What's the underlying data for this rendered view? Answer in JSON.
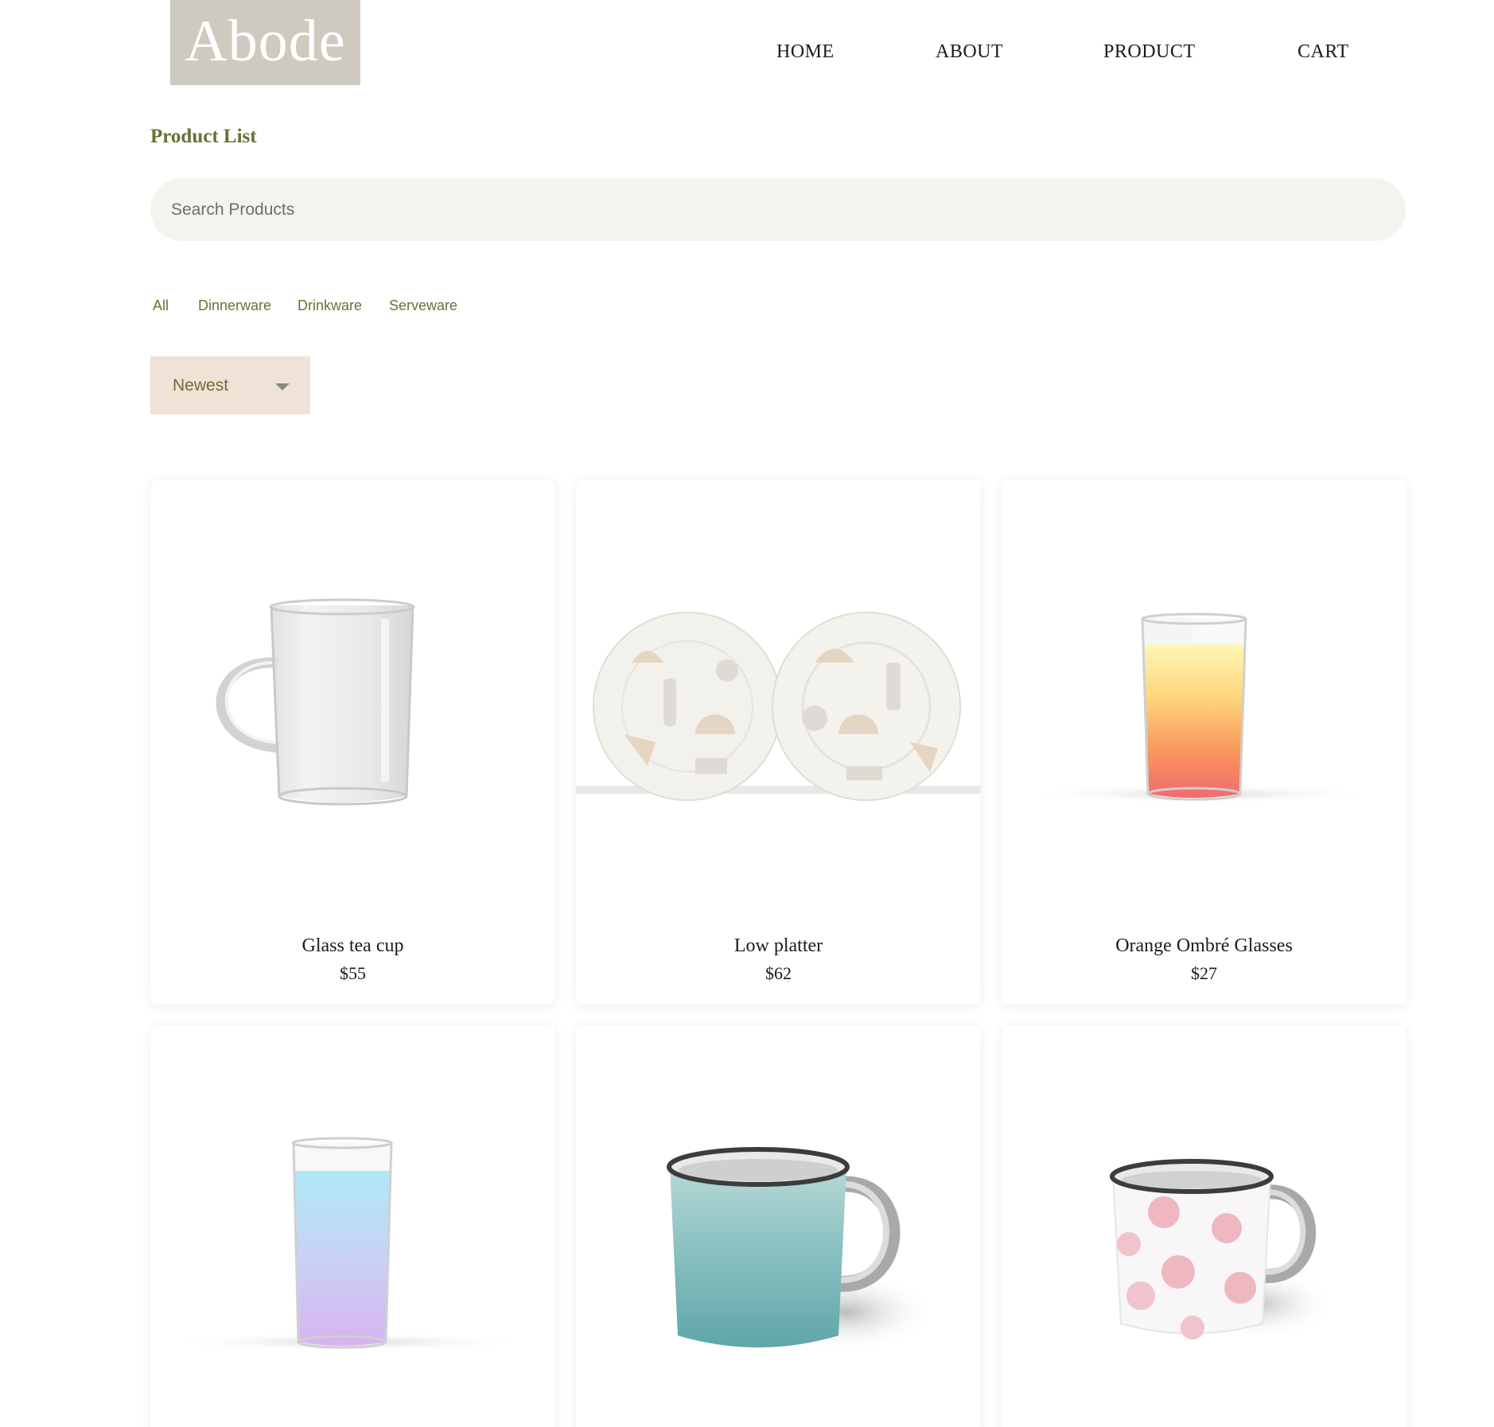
{
  "brand": {
    "logo_text": "Abode",
    "logo_bg": "#cfcac0"
  },
  "nav": {
    "home": "HOME",
    "about": "ABOUT",
    "product": "PRODUCT",
    "cart": "CART"
  },
  "page_title": "Product List",
  "search": {
    "placeholder": "Search Products",
    "value": ""
  },
  "filters": [
    "All",
    "Dinnerware",
    "Drinkware",
    "Serveware"
  ],
  "sort": {
    "selected": "Newest"
  },
  "products": [
    {
      "name": "Glass tea cup",
      "price": "$55",
      "image": "glass-tea-cup"
    },
    {
      "name": "Low platter",
      "price": "$62",
      "image": "patterned-plates"
    },
    {
      "name": "Orange Ombré Glasses",
      "price": "$27",
      "image": "orange-ombre-glass"
    },
    {
      "name": "",
      "price": "",
      "image": "blue-purple-ombre-glass"
    },
    {
      "name": "",
      "price": "",
      "image": "teal-enamel-mug"
    },
    {
      "name": "",
      "price": "",
      "image": "pink-dot-enamel-mug"
    }
  ],
  "colors": {
    "accent_olive": "#6b7035",
    "search_bg": "#f4f3ee",
    "sort_bg": "#efe2d6"
  }
}
